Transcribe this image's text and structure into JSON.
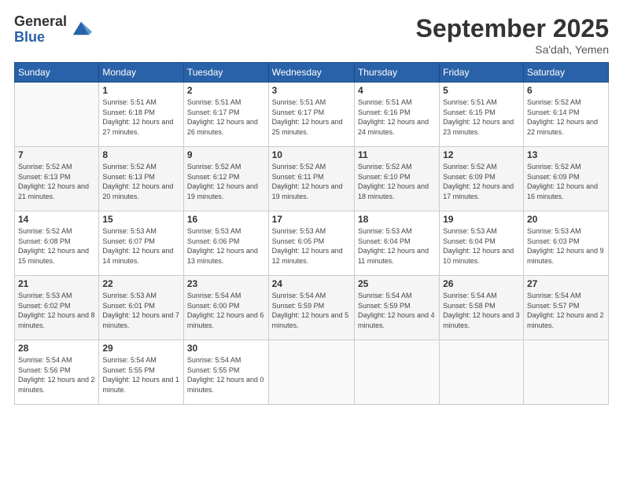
{
  "logo": {
    "general": "General",
    "blue": "Blue"
  },
  "title": "September 2025",
  "location": "Sa'dah, Yemen",
  "days_header": [
    "Sunday",
    "Monday",
    "Tuesday",
    "Wednesday",
    "Thursday",
    "Friday",
    "Saturday"
  ],
  "weeks": [
    [
      {
        "day": "",
        "sunrise": "",
        "sunset": "",
        "daylight": ""
      },
      {
        "day": "1",
        "sunrise": "Sunrise: 5:51 AM",
        "sunset": "Sunset: 6:18 PM",
        "daylight": "Daylight: 12 hours and 27 minutes."
      },
      {
        "day": "2",
        "sunrise": "Sunrise: 5:51 AM",
        "sunset": "Sunset: 6:17 PM",
        "daylight": "Daylight: 12 hours and 26 minutes."
      },
      {
        "day": "3",
        "sunrise": "Sunrise: 5:51 AM",
        "sunset": "Sunset: 6:17 PM",
        "daylight": "Daylight: 12 hours and 25 minutes."
      },
      {
        "day": "4",
        "sunrise": "Sunrise: 5:51 AM",
        "sunset": "Sunset: 6:16 PM",
        "daylight": "Daylight: 12 hours and 24 minutes."
      },
      {
        "day": "5",
        "sunrise": "Sunrise: 5:51 AM",
        "sunset": "Sunset: 6:15 PM",
        "daylight": "Daylight: 12 hours and 23 minutes."
      },
      {
        "day": "6",
        "sunrise": "Sunrise: 5:52 AM",
        "sunset": "Sunset: 6:14 PM",
        "daylight": "Daylight: 12 hours and 22 minutes."
      }
    ],
    [
      {
        "day": "7",
        "sunrise": "Sunrise: 5:52 AM",
        "sunset": "Sunset: 6:13 PM",
        "daylight": "Daylight: 12 hours and 21 minutes."
      },
      {
        "day": "8",
        "sunrise": "Sunrise: 5:52 AM",
        "sunset": "Sunset: 6:13 PM",
        "daylight": "Daylight: 12 hours and 20 minutes."
      },
      {
        "day": "9",
        "sunrise": "Sunrise: 5:52 AM",
        "sunset": "Sunset: 6:12 PM",
        "daylight": "Daylight: 12 hours and 19 minutes."
      },
      {
        "day": "10",
        "sunrise": "Sunrise: 5:52 AM",
        "sunset": "Sunset: 6:11 PM",
        "daylight": "Daylight: 12 hours and 19 minutes."
      },
      {
        "day": "11",
        "sunrise": "Sunrise: 5:52 AM",
        "sunset": "Sunset: 6:10 PM",
        "daylight": "Daylight: 12 hours and 18 minutes."
      },
      {
        "day": "12",
        "sunrise": "Sunrise: 5:52 AM",
        "sunset": "Sunset: 6:09 PM",
        "daylight": "Daylight: 12 hours and 17 minutes."
      },
      {
        "day": "13",
        "sunrise": "Sunrise: 5:52 AM",
        "sunset": "Sunset: 6:09 PM",
        "daylight": "Daylight: 12 hours and 16 minutes."
      }
    ],
    [
      {
        "day": "14",
        "sunrise": "Sunrise: 5:52 AM",
        "sunset": "Sunset: 6:08 PM",
        "daylight": "Daylight: 12 hours and 15 minutes."
      },
      {
        "day": "15",
        "sunrise": "Sunrise: 5:53 AM",
        "sunset": "Sunset: 6:07 PM",
        "daylight": "Daylight: 12 hours and 14 minutes."
      },
      {
        "day": "16",
        "sunrise": "Sunrise: 5:53 AM",
        "sunset": "Sunset: 6:06 PM",
        "daylight": "Daylight: 12 hours and 13 minutes."
      },
      {
        "day": "17",
        "sunrise": "Sunrise: 5:53 AM",
        "sunset": "Sunset: 6:05 PM",
        "daylight": "Daylight: 12 hours and 12 minutes."
      },
      {
        "day": "18",
        "sunrise": "Sunrise: 5:53 AM",
        "sunset": "Sunset: 6:04 PM",
        "daylight": "Daylight: 12 hours and 11 minutes."
      },
      {
        "day": "19",
        "sunrise": "Sunrise: 5:53 AM",
        "sunset": "Sunset: 6:04 PM",
        "daylight": "Daylight: 12 hours and 10 minutes."
      },
      {
        "day": "20",
        "sunrise": "Sunrise: 5:53 AM",
        "sunset": "Sunset: 6:03 PM",
        "daylight": "Daylight: 12 hours and 9 minutes."
      }
    ],
    [
      {
        "day": "21",
        "sunrise": "Sunrise: 5:53 AM",
        "sunset": "Sunset: 6:02 PM",
        "daylight": "Daylight: 12 hours and 8 minutes."
      },
      {
        "day": "22",
        "sunrise": "Sunrise: 5:53 AM",
        "sunset": "Sunset: 6:01 PM",
        "daylight": "Daylight: 12 hours and 7 minutes."
      },
      {
        "day": "23",
        "sunrise": "Sunrise: 5:54 AM",
        "sunset": "Sunset: 6:00 PM",
        "daylight": "Daylight: 12 hours and 6 minutes."
      },
      {
        "day": "24",
        "sunrise": "Sunrise: 5:54 AM",
        "sunset": "Sunset: 5:59 PM",
        "daylight": "Daylight: 12 hours and 5 minutes."
      },
      {
        "day": "25",
        "sunrise": "Sunrise: 5:54 AM",
        "sunset": "Sunset: 5:59 PM",
        "daylight": "Daylight: 12 hours and 4 minutes."
      },
      {
        "day": "26",
        "sunrise": "Sunrise: 5:54 AM",
        "sunset": "Sunset: 5:58 PM",
        "daylight": "Daylight: 12 hours and 3 minutes."
      },
      {
        "day": "27",
        "sunrise": "Sunrise: 5:54 AM",
        "sunset": "Sunset: 5:57 PM",
        "daylight": "Daylight: 12 hours and 2 minutes."
      }
    ],
    [
      {
        "day": "28",
        "sunrise": "Sunrise: 5:54 AM",
        "sunset": "Sunset: 5:56 PM",
        "daylight": "Daylight: 12 hours and 2 minutes."
      },
      {
        "day": "29",
        "sunrise": "Sunrise: 5:54 AM",
        "sunset": "Sunset: 5:55 PM",
        "daylight": "Daylight: 12 hours and 1 minute."
      },
      {
        "day": "30",
        "sunrise": "Sunrise: 5:54 AM",
        "sunset": "Sunset: 5:55 PM",
        "daylight": "Daylight: 12 hours and 0 minutes."
      },
      {
        "day": "",
        "sunrise": "",
        "sunset": "",
        "daylight": ""
      },
      {
        "day": "",
        "sunrise": "",
        "sunset": "",
        "daylight": ""
      },
      {
        "day": "",
        "sunrise": "",
        "sunset": "",
        "daylight": ""
      },
      {
        "day": "",
        "sunrise": "",
        "sunset": "",
        "daylight": ""
      }
    ]
  ]
}
